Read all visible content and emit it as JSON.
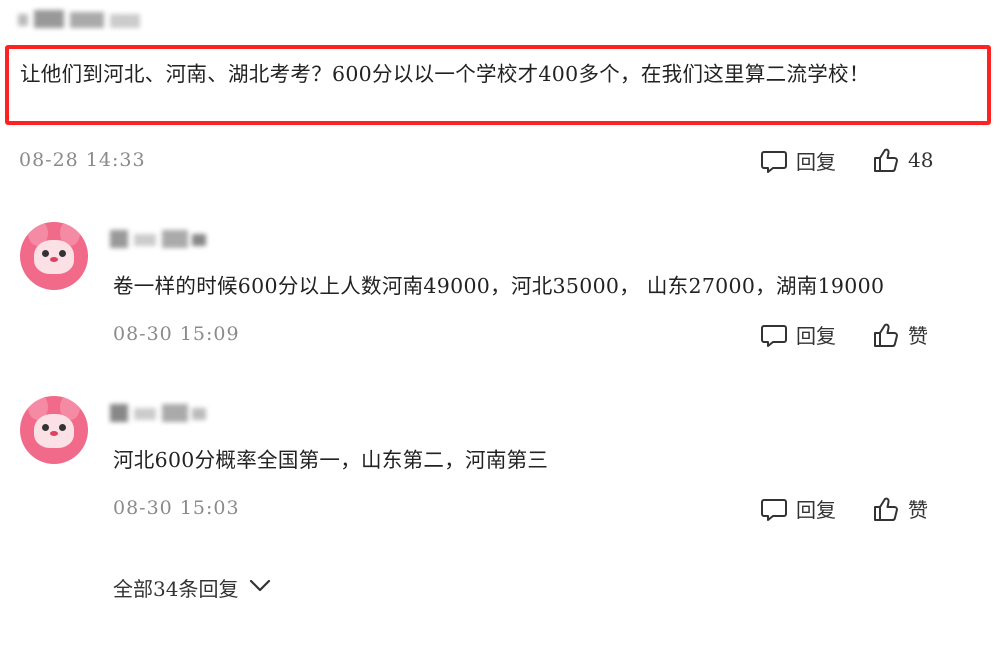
{
  "top_comment": {
    "text": "让他们到河北、河南、湖北考考？600分以以一个学校才400多个，在我们这里算二流学校！",
    "timestamp": "08-28 14:33",
    "reply_label": "回复",
    "like_count": "48"
  },
  "replies": [
    {
      "text": "卷一样的时候600分以上人数河南49000，河北35000， 山东27000，湖南19000",
      "timestamp": "08-30 15:09",
      "reply_label": "回复",
      "like_label": "赞"
    },
    {
      "text": "河北600分概率全国第一，山东第二，河南第三",
      "timestamp": "08-30 15:03",
      "reply_label": "回复",
      "like_label": "赞"
    }
  ],
  "expand": {
    "label": "全部34条回复"
  },
  "colors": {
    "highlight": "#ff2222",
    "timestamp": "#8a8a8a",
    "avatar": "#f26a8a"
  },
  "icons": {
    "reply": "comment-bubble-icon",
    "like": "thumbs-up-icon",
    "expand": "chevron-down-icon"
  }
}
